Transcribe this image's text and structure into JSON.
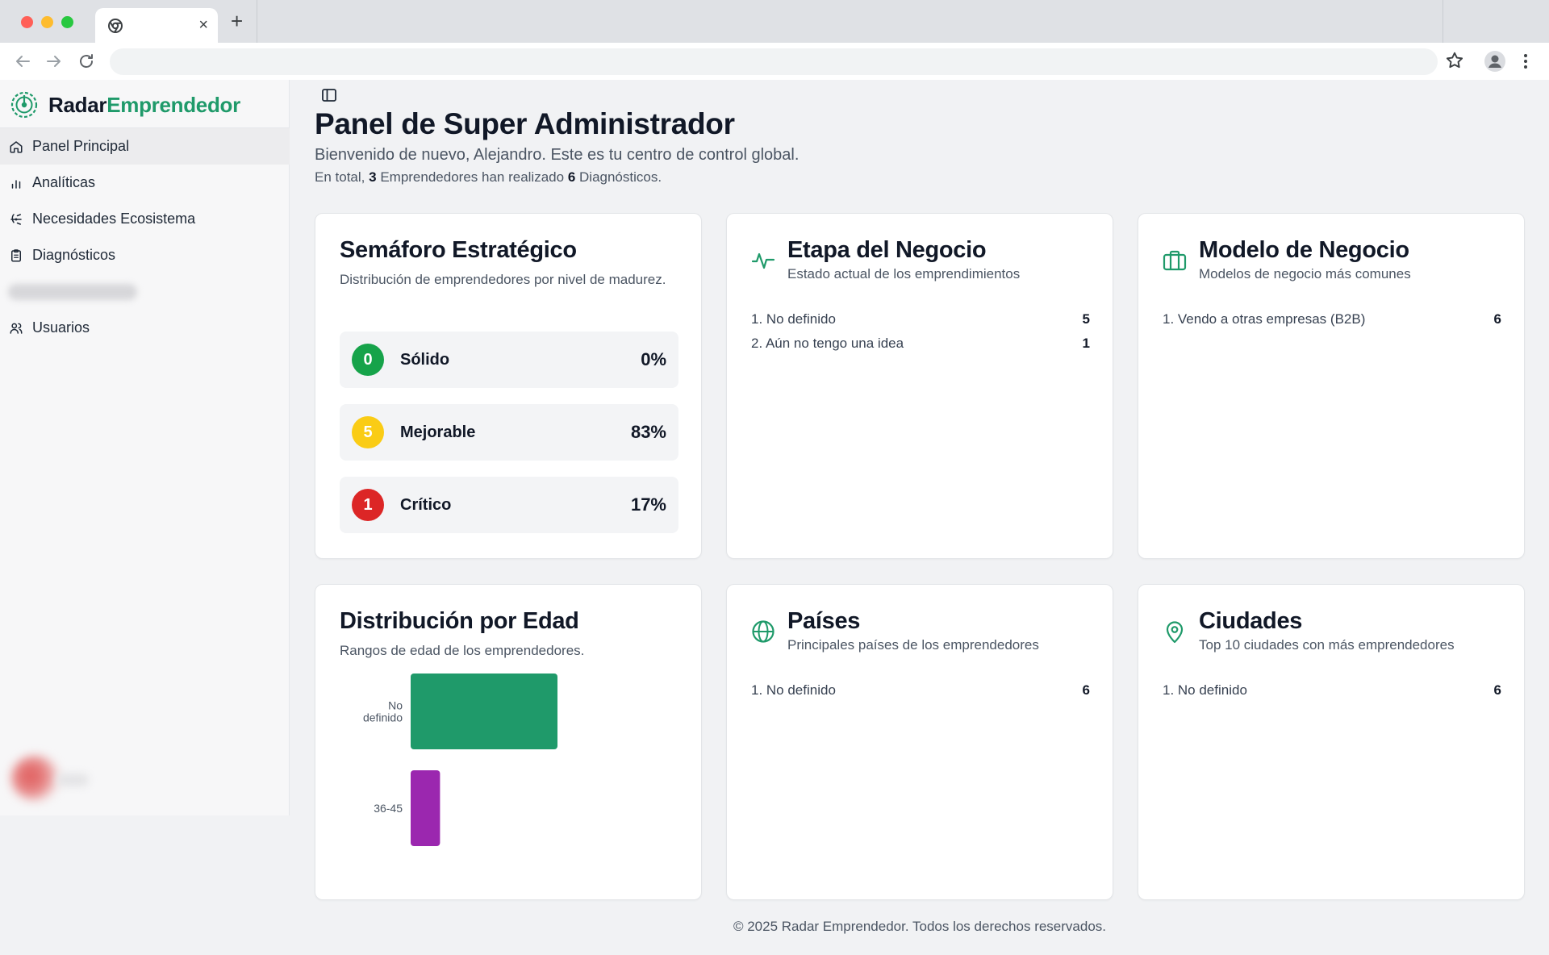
{
  "browser": {
    "tab_close": "×",
    "new_tab": "+"
  },
  "sidebar": {
    "brand_part1": "Radar",
    "brand_part2": "Emprendedor",
    "items": [
      {
        "label": "Panel Principal",
        "icon": "home-icon"
      },
      {
        "label": "Analíticas",
        "icon": "bar-chart-icon"
      },
      {
        "label": "Necesidades Ecosistema",
        "icon": "ecosystem-icon"
      },
      {
        "label": "Diagnósticos",
        "icon": "clipboard-icon"
      },
      {
        "label": "Usuarios",
        "icon": "users-icon"
      }
    ]
  },
  "header": {
    "title": "Panel de Super Administrador",
    "subtitle": "Bienvenido de nuevo, Alejandro. Este es tu centro de control global.",
    "total_prefix": "En total,",
    "entrepreneurs_count": "3",
    "entrepreneurs_text": "Emprendedores han realizado",
    "diagnostics_count": "6",
    "diagnostics_text": "Diagnósticos."
  },
  "semaforo": {
    "title": "Semáforo Estratégico",
    "description": "Distribución de emprendedores por nivel de madurez.",
    "levels": [
      {
        "count": "0",
        "label": "Sólido",
        "percent": "0%",
        "color": "#16a34a"
      },
      {
        "count": "5",
        "label": "Mejorable",
        "percent": "83%",
        "color": "#facc15"
      },
      {
        "count": "1",
        "label": "Crítico",
        "percent": "17%",
        "color": "#dc2626"
      }
    ]
  },
  "etapa": {
    "title": "Etapa del Negocio",
    "description": "Estado actual de los emprendimientos",
    "items": [
      {
        "label": "1. No definido",
        "value": "5"
      },
      {
        "label": "2. Aún no tengo una idea",
        "value": "1"
      }
    ]
  },
  "modelo": {
    "title": "Modelo de Negocio",
    "description": "Modelos de negocio más comunes",
    "items": [
      {
        "label": "1. Vendo a otras empresas (B2B)",
        "value": "6"
      }
    ]
  },
  "edad": {
    "title": "Distribución por Edad",
    "description": "Rangos de edad de los emprendedores."
  },
  "paises": {
    "title": "Países",
    "description": "Principales países de los emprendedores",
    "items": [
      {
        "label": "1. No definido",
        "value": "6"
      }
    ]
  },
  "ciudades": {
    "title": "Ciudades",
    "description": "Top 10 ciudades con más emprendedores",
    "items": [
      {
        "label": "1. No definido",
        "value": "6"
      }
    ]
  },
  "chart_data": {
    "type": "bar",
    "orientation": "horizontal",
    "categories": [
      "No definido",
      "36-45"
    ],
    "values": [
      5,
      1
    ],
    "colors": [
      "#1f9a6a",
      "#9b27af"
    ],
    "title": "",
    "xlabel": "",
    "ylabel": "",
    "grid": false
  },
  "colors": {
    "brand": "#1f9a6a",
    "accent_icon": "#1f9a6a"
  },
  "footer": {
    "text": "© 2025 Radar Emprendedor. Todos los derechos reservados."
  }
}
